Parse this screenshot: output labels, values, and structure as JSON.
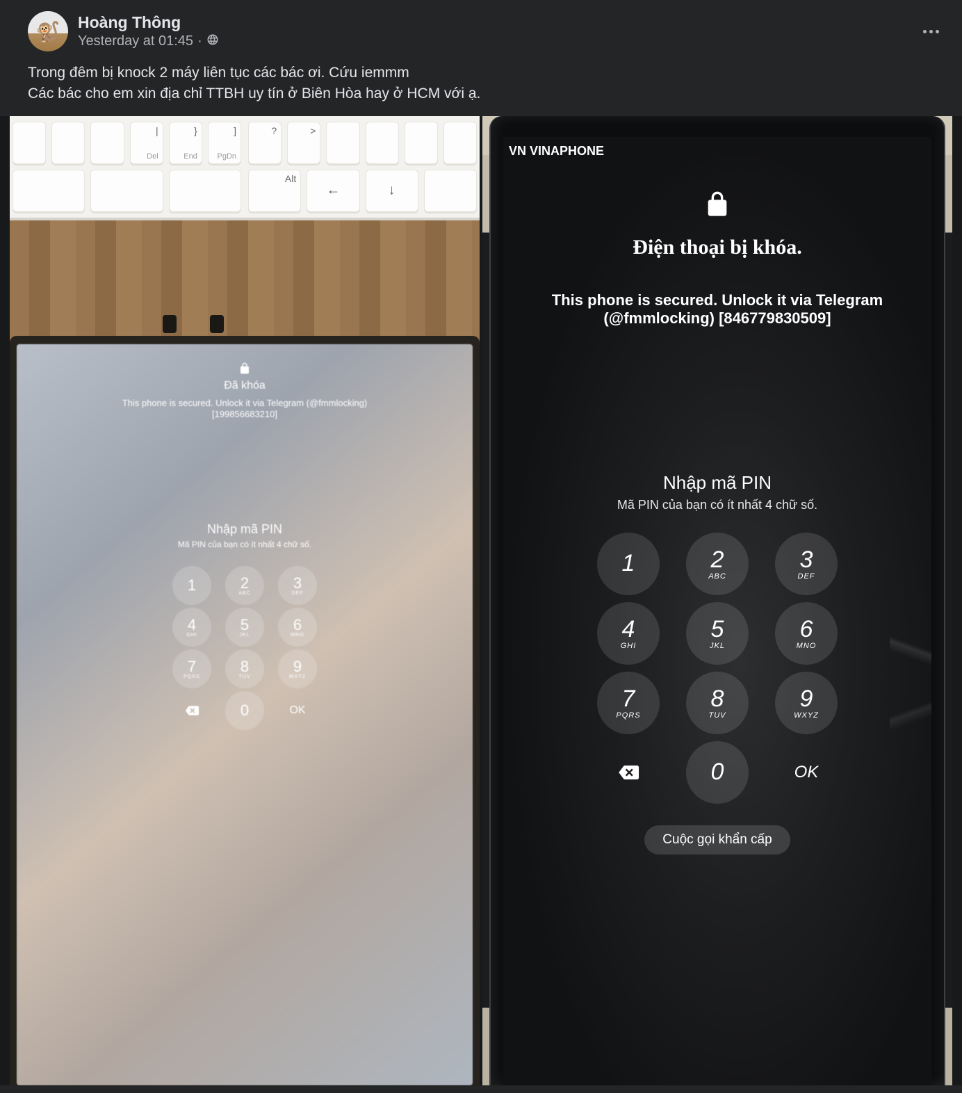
{
  "header": {
    "author": "Hoàng Thông",
    "timestamp": "Yesterday at 01:45",
    "separator": "·"
  },
  "body": {
    "line1": "Trong đêm bị knock 2 máy liên tục các bác ơi. Cứu iemmm",
    "line2": "Các bác cho em xin địa chỉ TTBH uy tín ở Biên Hòa hay ở HCM với ạ."
  },
  "keyboard": {
    "row1_left": [
      {
        "main": ""
      },
      {
        "main": ""
      },
      {
        "main": ""
      },
      {
        "sub": "|",
        "main": "Del"
      },
      {
        "sub": "}",
        "main": "End"
      },
      {
        "sub": "]",
        "main": "PgDn"
      }
    ],
    "row1_right": [
      {
        "sub": "?",
        "main": ""
      },
      {
        "sub": ">",
        "main": ""
      },
      {
        "main": ""
      },
      {
        "main": ""
      },
      {
        "main": ""
      },
      {
        "main": ""
      }
    ],
    "row2_left": [
      {
        "sub": "",
        "main": "",
        "wide": true
      },
      {
        "sub": "",
        "main": "",
        "wide": true
      },
      {
        "sub": "",
        "main": "",
        "wide": true
      }
    ],
    "row2_right": [
      {
        "sub": "Alt",
        "main": ""
      },
      {
        "sub": "",
        "big": "←"
      },
      {
        "sub": "",
        "big": "↓"
      },
      {
        "sub": "",
        "main": ""
      }
    ]
  },
  "tablet": {
    "locked_label": "Đã khóa",
    "msg_line1": "This phone is secured. Unlock it via Telegram (@fmmlocking)",
    "msg_line2": "[199856683210]",
    "pin_title": "Nhập mã PIN",
    "pin_sub": "Mã PIN của bạn có ít nhất 4 chữ số.",
    "keys": [
      {
        "n": "1",
        "l": ""
      },
      {
        "n": "2",
        "l": "ABC"
      },
      {
        "n": "3",
        "l": "DEF"
      },
      {
        "n": "4",
        "l": "GHI"
      },
      {
        "n": "5",
        "l": "JKL"
      },
      {
        "n": "6",
        "l": "MNO"
      },
      {
        "n": "7",
        "l": "PQRS"
      },
      {
        "n": "8",
        "l": "TUV"
      },
      {
        "n": "9",
        "l": "WXYZ"
      }
    ],
    "ok": "OK",
    "zero": "0"
  },
  "phone": {
    "carrier": "VN VINAPHONE",
    "locked_label": "Điện thoại bị khóa.",
    "msg_line1": "This phone is secured. Unlock it via Telegram",
    "msg_line2": "(@fmmlocking) [846779830509]",
    "pin_title": "Nhập mã PIN",
    "pin_sub": "Mã PIN của bạn có ít nhất 4 chữ số.",
    "keys": [
      {
        "n": "1",
        "l": ""
      },
      {
        "n": "2",
        "l": "ABC"
      },
      {
        "n": "3",
        "l": "DEF"
      },
      {
        "n": "4",
        "l": "GHI"
      },
      {
        "n": "5",
        "l": "JKL"
      },
      {
        "n": "6",
        "l": "MNO"
      },
      {
        "n": "7",
        "l": "PQRS"
      },
      {
        "n": "8",
        "l": "TUV"
      },
      {
        "n": "9",
        "l": "WXYZ"
      }
    ],
    "ok": "OK",
    "zero": "0",
    "emergency": "Cuộc gọi khẩn cấp"
  }
}
